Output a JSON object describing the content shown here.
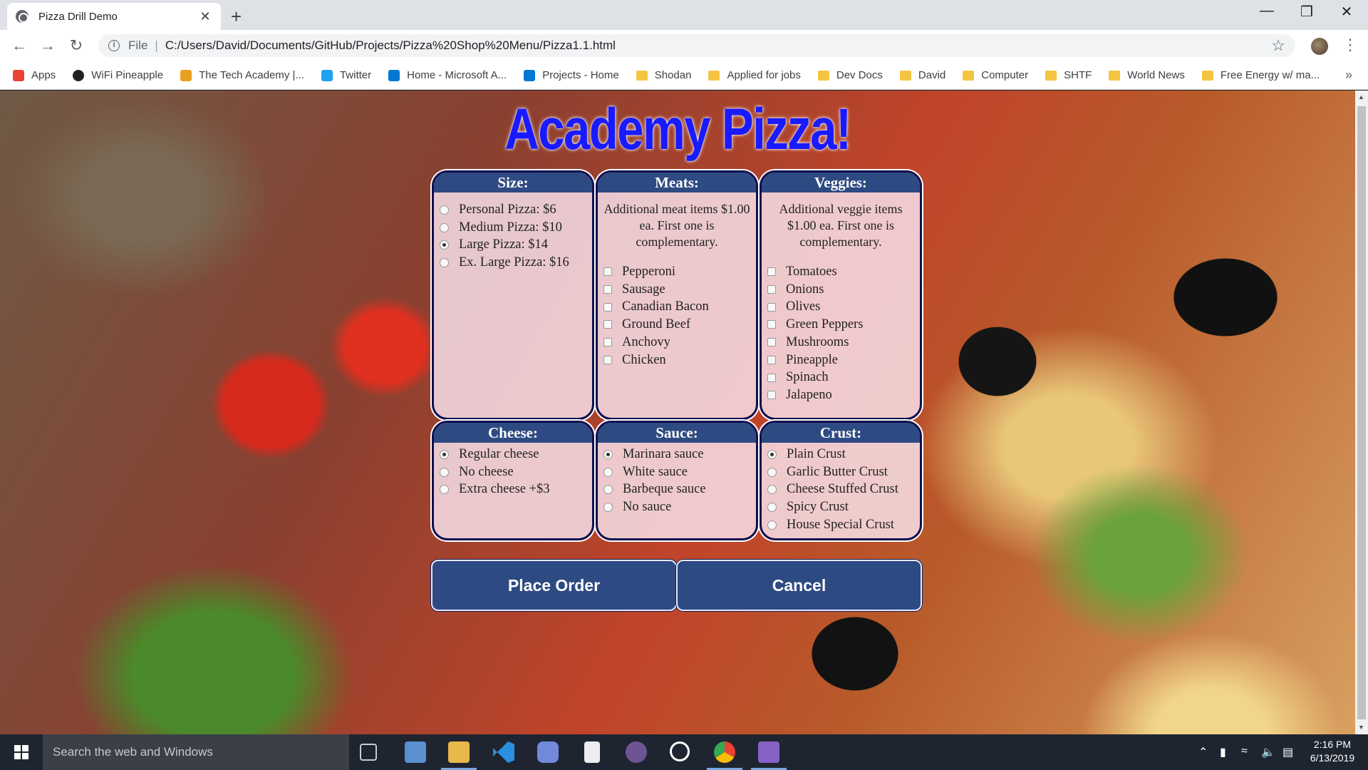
{
  "browser": {
    "tab_title": "Pizza Drill Demo",
    "tab_close": "✕",
    "new_tab": "+",
    "scheme": "File",
    "separator": "|",
    "url": "C:/Users/David/Documents/GitHub/Projects/Pizza%20Shop%20Menu/Pizza1.1.html",
    "bookmarks": [
      {
        "label": "Apps",
        "icon": "apps-grid-icon"
      },
      {
        "label": "WiFi Pineapple",
        "icon": "pineapple-icon"
      },
      {
        "label": "The Tech Academy |...",
        "icon": "tech-academy-icon"
      },
      {
        "label": "Twitter",
        "icon": "twitter-icon"
      },
      {
        "label": "Home - Microsoft A...",
        "icon": "azure-icon"
      },
      {
        "label": "Projects - Home",
        "icon": "devops-icon"
      },
      {
        "label": "Shodan",
        "icon": "folder-icon"
      },
      {
        "label": "Applied for jobs",
        "icon": "folder-icon"
      },
      {
        "label": "Dev Docs",
        "icon": "folder-icon"
      },
      {
        "label": "David",
        "icon": "folder-icon"
      },
      {
        "label": "Computer",
        "icon": "folder-icon"
      },
      {
        "label": "SHTF",
        "icon": "folder-icon"
      },
      {
        "label": "World News",
        "icon": "folder-icon"
      },
      {
        "label": "Free Energy w/ ma...",
        "icon": "folder-icon"
      }
    ],
    "more": "»"
  },
  "page": {
    "title": "Academy Pizza!",
    "size": {
      "heading": "Size:",
      "options": [
        {
          "label": "Personal Pizza: $6",
          "checked": false
        },
        {
          "label": "Medium Pizza: $10",
          "checked": false
        },
        {
          "label": "Large Pizza: $14",
          "checked": true
        },
        {
          "label": "Ex. Large Pizza: $16",
          "checked": false
        }
      ]
    },
    "meats": {
      "heading": "Meats:",
      "note": "Additional meat items $1.00 ea. First one is complementary.",
      "options": [
        "Pepperoni",
        "Sausage",
        "Canadian Bacon",
        "Ground Beef",
        "Anchovy",
        "Chicken"
      ]
    },
    "veggies": {
      "heading": "Veggies:",
      "note": "Additional veggie items $1.00 ea. First one is complementary.",
      "options": [
        "Tomatoes",
        "Onions",
        "Olives",
        "Green Peppers",
        "Mushrooms",
        "Pineapple",
        "Spinach",
        "Jalapeno"
      ]
    },
    "cheese": {
      "heading": "Cheese:",
      "options": [
        {
          "label": "Regular cheese",
          "checked": true
        },
        {
          "label": "No cheese",
          "checked": false
        },
        {
          "label": "Extra cheese +$3",
          "checked": false
        }
      ]
    },
    "sauce": {
      "heading": "Sauce:",
      "options": [
        {
          "label": "Marinara sauce",
          "checked": true
        },
        {
          "label": "White sauce",
          "checked": false
        },
        {
          "label": "Barbeque sauce",
          "checked": false
        },
        {
          "label": "No sauce",
          "checked": false
        }
      ]
    },
    "crust": {
      "heading": "Crust:",
      "options": [
        {
          "label": "Plain Crust",
          "checked": true
        },
        {
          "label": "Garlic Butter Crust",
          "checked": false
        },
        {
          "label": "Cheese Stuffed Crust",
          "checked": false
        },
        {
          "label": "Spicy Crust",
          "checked": false
        },
        {
          "label": "House Special Crust",
          "checked": false
        }
      ]
    },
    "buttons": {
      "place_order": "Place Order",
      "cancel": "Cancel"
    }
  },
  "taskbar": {
    "search_placeholder": "Search the web and Windows",
    "time": "2:16 PM",
    "date": "6/13/2019"
  },
  "colors": {
    "title_blue": "#1a1aff",
    "panel_header": "#2e4a82",
    "panel_border": "#101050"
  }
}
